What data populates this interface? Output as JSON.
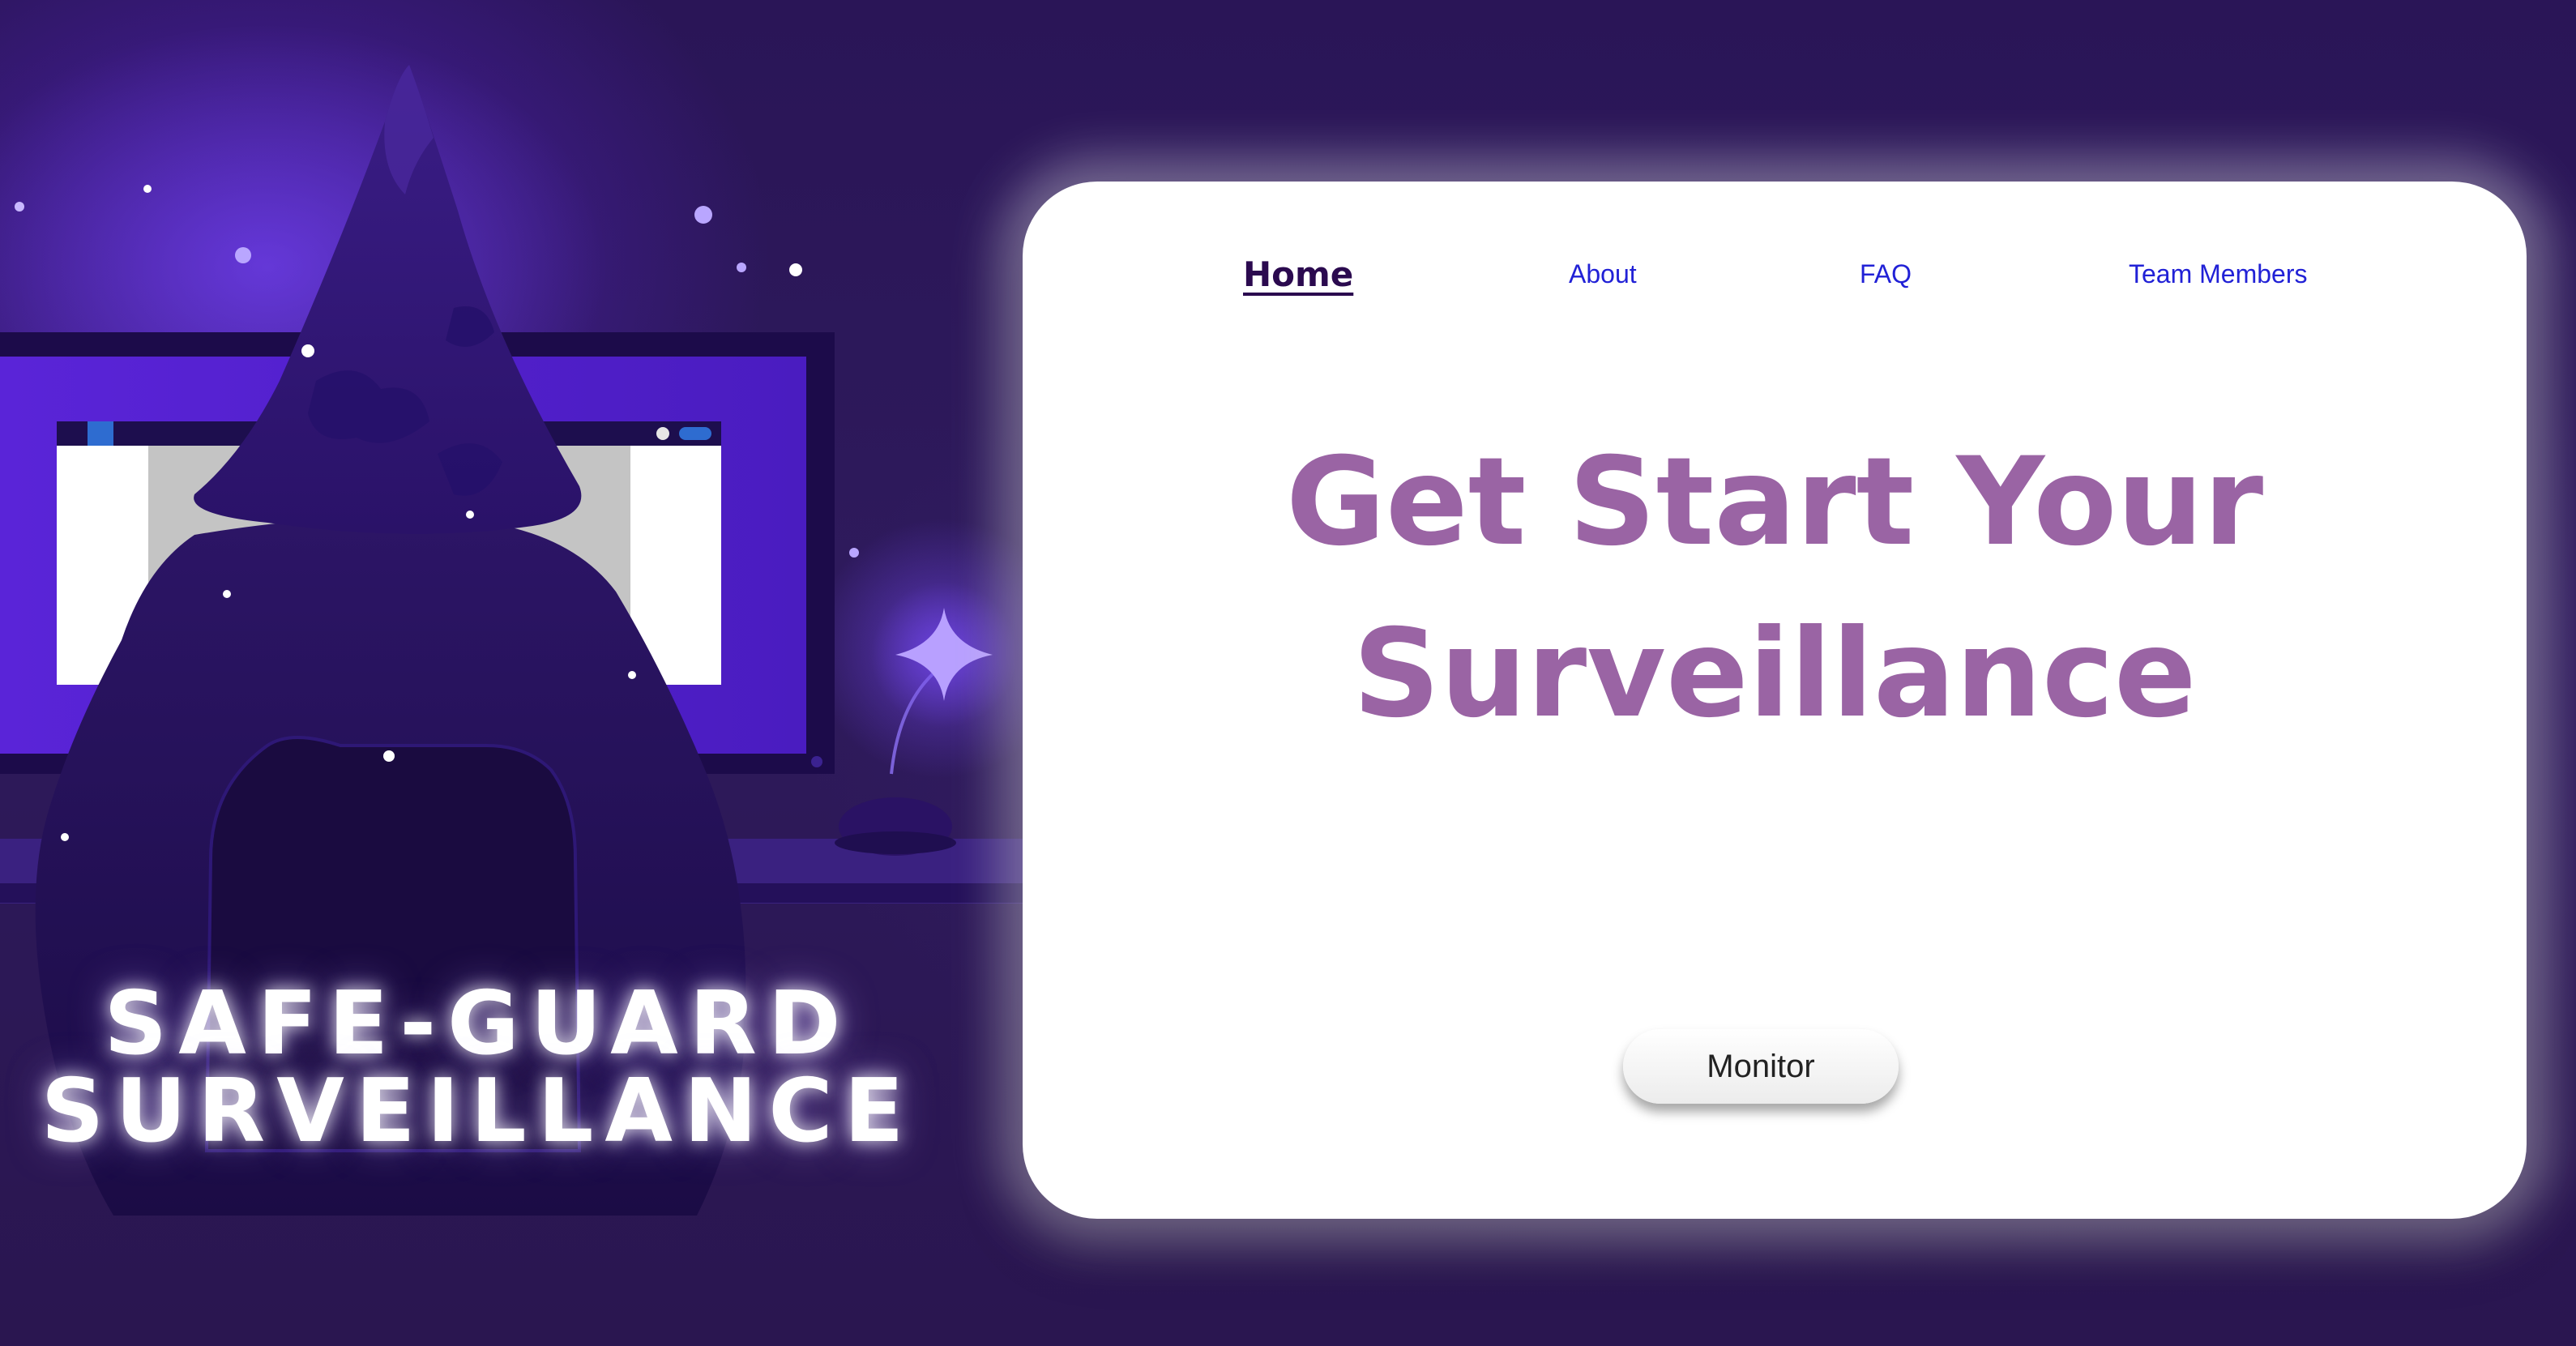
{
  "brand": {
    "line1": "SAFE-GUARD",
    "line2": "SURVEILLANCE"
  },
  "nav": {
    "items": [
      {
        "label": "Home",
        "active": true
      },
      {
        "label": "About",
        "active": false
      },
      {
        "label": "FAQ",
        "active": false
      },
      {
        "label": "Team Members",
        "active": false
      }
    ]
  },
  "hero": {
    "line1": "Get Start Your",
    "line2": "Surveillance"
  },
  "cta": {
    "label": "Monitor"
  },
  "colors": {
    "background": "#2e1a5c",
    "hero_text": "#9a64a4",
    "nav_link": "#2121d6",
    "nav_active": "#2b0a4f",
    "card": "#ffffff"
  }
}
